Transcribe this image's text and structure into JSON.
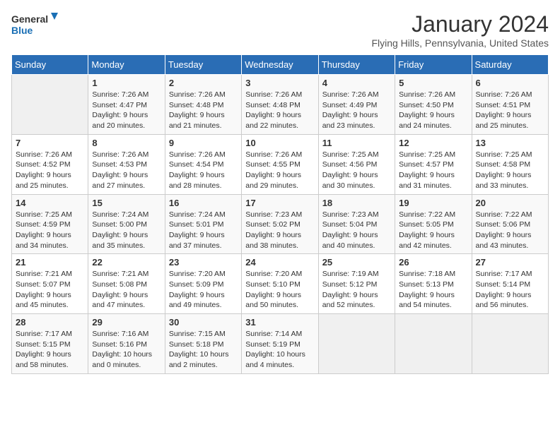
{
  "logo": {
    "line1": "General",
    "line2": "Blue"
  },
  "title": "January 2024",
  "location": "Flying Hills, Pennsylvania, United States",
  "days_of_week": [
    "Sunday",
    "Monday",
    "Tuesday",
    "Wednesday",
    "Thursday",
    "Friday",
    "Saturday"
  ],
  "weeks": [
    [
      {
        "day": "",
        "info": ""
      },
      {
        "day": "1",
        "info": "Sunrise: 7:26 AM\nSunset: 4:47 PM\nDaylight: 9 hours\nand 20 minutes."
      },
      {
        "day": "2",
        "info": "Sunrise: 7:26 AM\nSunset: 4:48 PM\nDaylight: 9 hours\nand 21 minutes."
      },
      {
        "day": "3",
        "info": "Sunrise: 7:26 AM\nSunset: 4:48 PM\nDaylight: 9 hours\nand 22 minutes."
      },
      {
        "day": "4",
        "info": "Sunrise: 7:26 AM\nSunset: 4:49 PM\nDaylight: 9 hours\nand 23 minutes."
      },
      {
        "day": "5",
        "info": "Sunrise: 7:26 AM\nSunset: 4:50 PM\nDaylight: 9 hours\nand 24 minutes."
      },
      {
        "day": "6",
        "info": "Sunrise: 7:26 AM\nSunset: 4:51 PM\nDaylight: 9 hours\nand 25 minutes."
      }
    ],
    [
      {
        "day": "7",
        "info": "Sunrise: 7:26 AM\nSunset: 4:52 PM\nDaylight: 9 hours\nand 25 minutes."
      },
      {
        "day": "8",
        "info": "Sunrise: 7:26 AM\nSunset: 4:53 PM\nDaylight: 9 hours\nand 27 minutes."
      },
      {
        "day": "9",
        "info": "Sunrise: 7:26 AM\nSunset: 4:54 PM\nDaylight: 9 hours\nand 28 minutes."
      },
      {
        "day": "10",
        "info": "Sunrise: 7:26 AM\nSunset: 4:55 PM\nDaylight: 9 hours\nand 29 minutes."
      },
      {
        "day": "11",
        "info": "Sunrise: 7:25 AM\nSunset: 4:56 PM\nDaylight: 9 hours\nand 30 minutes."
      },
      {
        "day": "12",
        "info": "Sunrise: 7:25 AM\nSunset: 4:57 PM\nDaylight: 9 hours\nand 31 minutes."
      },
      {
        "day": "13",
        "info": "Sunrise: 7:25 AM\nSunset: 4:58 PM\nDaylight: 9 hours\nand 33 minutes."
      }
    ],
    [
      {
        "day": "14",
        "info": "Sunrise: 7:25 AM\nSunset: 4:59 PM\nDaylight: 9 hours\nand 34 minutes."
      },
      {
        "day": "15",
        "info": "Sunrise: 7:24 AM\nSunset: 5:00 PM\nDaylight: 9 hours\nand 35 minutes."
      },
      {
        "day": "16",
        "info": "Sunrise: 7:24 AM\nSunset: 5:01 PM\nDaylight: 9 hours\nand 37 minutes."
      },
      {
        "day": "17",
        "info": "Sunrise: 7:23 AM\nSunset: 5:02 PM\nDaylight: 9 hours\nand 38 minutes."
      },
      {
        "day": "18",
        "info": "Sunrise: 7:23 AM\nSunset: 5:04 PM\nDaylight: 9 hours\nand 40 minutes."
      },
      {
        "day": "19",
        "info": "Sunrise: 7:22 AM\nSunset: 5:05 PM\nDaylight: 9 hours\nand 42 minutes."
      },
      {
        "day": "20",
        "info": "Sunrise: 7:22 AM\nSunset: 5:06 PM\nDaylight: 9 hours\nand 43 minutes."
      }
    ],
    [
      {
        "day": "21",
        "info": "Sunrise: 7:21 AM\nSunset: 5:07 PM\nDaylight: 9 hours\nand 45 minutes."
      },
      {
        "day": "22",
        "info": "Sunrise: 7:21 AM\nSunset: 5:08 PM\nDaylight: 9 hours\nand 47 minutes."
      },
      {
        "day": "23",
        "info": "Sunrise: 7:20 AM\nSunset: 5:09 PM\nDaylight: 9 hours\nand 49 minutes."
      },
      {
        "day": "24",
        "info": "Sunrise: 7:20 AM\nSunset: 5:10 PM\nDaylight: 9 hours\nand 50 minutes."
      },
      {
        "day": "25",
        "info": "Sunrise: 7:19 AM\nSunset: 5:12 PM\nDaylight: 9 hours\nand 52 minutes."
      },
      {
        "day": "26",
        "info": "Sunrise: 7:18 AM\nSunset: 5:13 PM\nDaylight: 9 hours\nand 54 minutes."
      },
      {
        "day": "27",
        "info": "Sunrise: 7:17 AM\nSunset: 5:14 PM\nDaylight: 9 hours\nand 56 minutes."
      }
    ],
    [
      {
        "day": "28",
        "info": "Sunrise: 7:17 AM\nSunset: 5:15 PM\nDaylight: 9 hours\nand 58 minutes."
      },
      {
        "day": "29",
        "info": "Sunrise: 7:16 AM\nSunset: 5:16 PM\nDaylight: 10 hours\nand 0 minutes."
      },
      {
        "day": "30",
        "info": "Sunrise: 7:15 AM\nSunset: 5:18 PM\nDaylight: 10 hours\nand 2 minutes."
      },
      {
        "day": "31",
        "info": "Sunrise: 7:14 AM\nSunset: 5:19 PM\nDaylight: 10 hours\nand 4 minutes."
      },
      {
        "day": "",
        "info": ""
      },
      {
        "day": "",
        "info": ""
      },
      {
        "day": "",
        "info": ""
      }
    ]
  ]
}
